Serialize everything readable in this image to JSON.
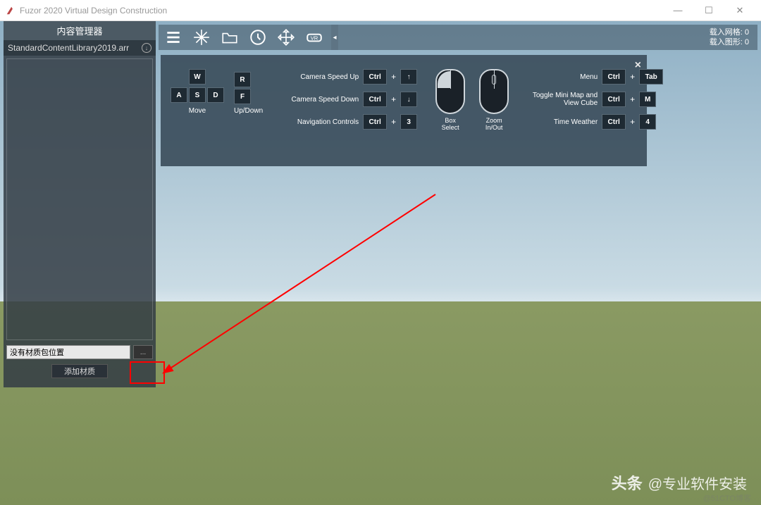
{
  "window": {
    "title": "Fuzor 2020 Virtual Design Construction"
  },
  "sidebar": {
    "title": "内容管理器",
    "library_file": "StandardContentLibrary2019.arr",
    "material_path_placeholder": "没有材质包位置",
    "browse_label": "...",
    "add_material_label": "添加材质"
  },
  "status": {
    "meshes_label": "载入网格:",
    "meshes_value": "0",
    "shapes_label": "载入图形:",
    "shapes_value": "0"
  },
  "help": {
    "move_label": "Move",
    "updown_label": "Up/Down",
    "keys": {
      "W": "W",
      "A": "A",
      "S": "S",
      "D": "D",
      "R": "R",
      "F": "F"
    },
    "rows_left": [
      {
        "label": "Camera Speed Up",
        "k1": "Ctrl",
        "k2": "↑"
      },
      {
        "label": "Camera Speed Down",
        "k1": "Ctrl",
        "k2": "↓"
      },
      {
        "label": "Navigation Controls",
        "k1": "Ctrl",
        "k2": "3"
      }
    ],
    "mouse": {
      "box_select": "Box Select",
      "zoom": "Zoom\nIn/Out"
    },
    "rows_right": [
      {
        "label": "Menu",
        "k1": "Ctrl",
        "k2": "Tab"
      },
      {
        "label": "Toggle Mini Map and View Cube",
        "k1": "Ctrl",
        "k2": "M"
      },
      {
        "label": "Time Weather",
        "k1": "Ctrl",
        "k2": "4"
      }
    ],
    "plus": "+"
  },
  "watermark": {
    "toutiao": "头条",
    "at": "@专业软件安装",
    "blog": "@51CTO博客"
  }
}
